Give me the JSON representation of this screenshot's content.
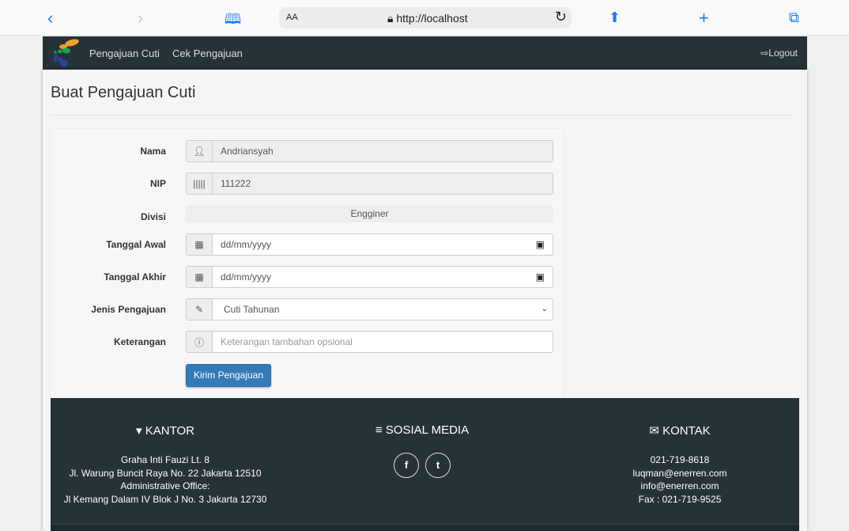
{
  "browser": {
    "text_size": "AA",
    "url": "http://localhost"
  },
  "nav": {
    "items": [
      "Pengajuan Cuti",
      "Cek Pengajuan"
    ],
    "logout": "Logout"
  },
  "page": {
    "title": "Buat Pengajuan Cuti"
  },
  "form": {
    "nama": {
      "label": "Nama",
      "value": "Andriansyah"
    },
    "nip": {
      "label": "NIP",
      "value": "111222"
    },
    "divisi": {
      "label": "Divisi",
      "value": "Engginer"
    },
    "tanggal_awal": {
      "label": "Tanggal Awal",
      "placeholder": "dd/mm/yyyy"
    },
    "tanggal_akhir": {
      "label": "Tanggal Akhir",
      "placeholder": "dd/mm/yyyy"
    },
    "jenis": {
      "label": "Jenis Pengajuan",
      "value": "Cuti Tahunan"
    },
    "keterangan": {
      "label": "Keterangan",
      "placeholder": "Keterangan tambahan opsional"
    },
    "submit": "Kirim Pengajuan"
  },
  "footer": {
    "kantor": {
      "title": "KANTOR",
      "lines": [
        "Graha Inti Fauzi Lt. 8",
        "Jl. Warung Buncit Raya No. 22 Jakarta 12510",
        "Administrative Office:",
        "Jl Kemang Dalam IV Blok J No. 3 Jakarta 12730"
      ]
    },
    "sosial": {
      "title": "SOSIAL MEDIA",
      "facebook": "f",
      "twitter": "t"
    },
    "kontak": {
      "title": "KONTAK",
      "lines": [
        "021-719-8618",
        "luqman@enerren.com",
        "info@enerren.com",
        "Fax : 021-719-9525"
      ]
    }
  }
}
